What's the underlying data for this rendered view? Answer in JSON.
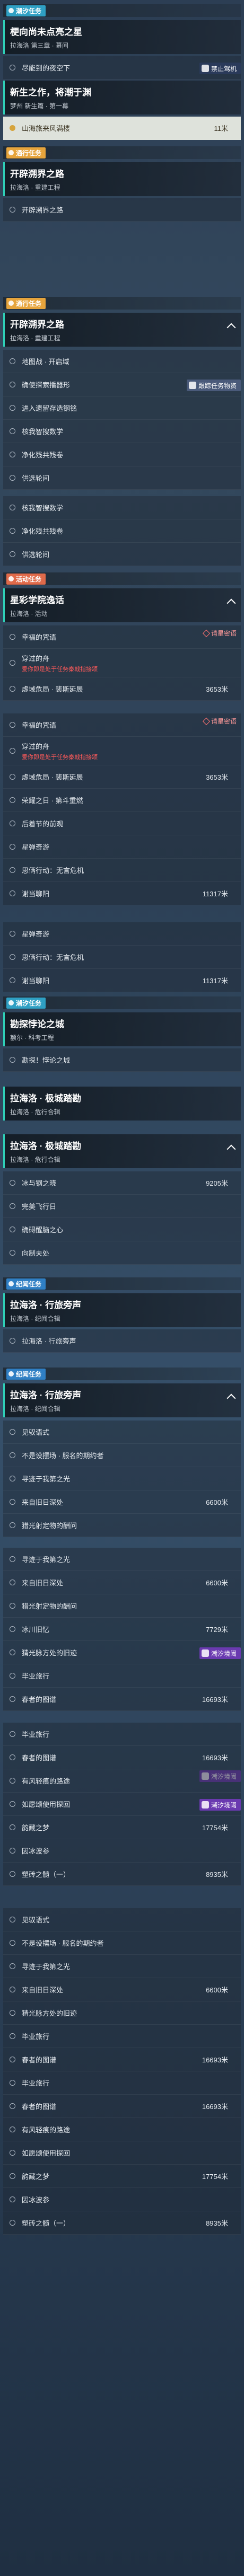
{
  "sections": {
    "chaoxi_1": "潮汐任务",
    "tongxing_1": "通行任务",
    "tongxing_2": "通行任务",
    "huodong": "活动任务",
    "chaoxi_2": "潮汐任务",
    "jiwen_1": "纪闻任务",
    "jiwen_2": "纪闻任务"
  },
  "tags": {
    "forbidden_drive": "禁止驾机",
    "follow_hint": "跟踪任务物资",
    "star_loc": "请星密语",
    "star_loc2": "请星密语",
    "chaoxi_hint": "潮汐境阈",
    "chaoxi_hint2": "潮汐境阈",
    "chaoxi_hint3": "潮汐境阈"
  },
  "quests": {
    "q1": {
      "title": "梗向尚未点亮之星",
      "sub": "拉海洛 第三章 · 幕间"
    },
    "q2": {
      "title": "新生之作，将潮于渊",
      "sub": "梦州 新生篇 · 第一幕"
    },
    "q3": {
      "title": "开辟溯界之路",
      "sub": "拉海洛 · 重建工程"
    },
    "q4": {
      "title": "开辟溯界之路",
      "sub": "拉海洛 · 重建工程"
    },
    "q5": {
      "title": "星彩学院逸话",
      "sub": "拉海洛 · 活动"
    },
    "q6": {
      "title": "勘探悖论之城",
      "sub": "额尔 · 科考工程"
    },
    "q7": {
      "title": "拉海洛 · 极城踏勘",
      "sub": "拉海洛 · 危行合辑"
    },
    "q8": {
      "title": "拉海洛 · 行旅旁声",
      "sub": "拉海洛 · 纪闻合辑"
    }
  },
  "rows": [
    {
      "t": "尽能到的夜空下"
    },
    {
      "t": "山海旅来风满楼",
      "d": "11米",
      "hl": true
    },
    {
      "t": "开辟溯界之路"
    },
    {
      "t": "地图战 · 开启域"
    },
    {
      "t": "确使探索播器形"
    },
    {
      "t": "进入遗留存选钢铭"
    },
    {
      "t": "核我智搜数学"
    },
    {
      "t": "净化残共残卷"
    },
    {
      "t": "供选轮间"
    },
    {
      "t": "核我智搜数学"
    },
    {
      "t": "净化残共残卷"
    },
    {
      "t": "供选轮间"
    },
    {
      "t": "幸福的咒语"
    },
    {
      "t": "穿过的舟",
      "red": "爱你即是处于任务秦戟指接颂"
    },
    {
      "t": "虚域危局 · 裴斯延展",
      "d": "3653米"
    },
    {
      "t": "幸福的咒语"
    },
    {
      "t": "穿过的舟",
      "red": "爱你即是处于任务秦戟指接颂"
    },
    {
      "t": "虚域危局 · 裴斯延展",
      "d": "3653米"
    },
    {
      "t": "荣耀之日 · 第斗重燃"
    },
    {
      "t": "后着节的前观"
    },
    {
      "t": "星弹奇游"
    },
    {
      "t": "思俩行动：无言危机"
    },
    {
      "t": "谢当聊阳",
      "d": "11317米"
    },
    {
      "t": "星弹奇游"
    },
    {
      "t": "思俩行动：无言危机"
    },
    {
      "t": "谢当聊阳",
      "d": "11317米"
    },
    {
      "t": "勘探悖论之城"
    },
    {
      "t": "勘探！悖论之城"
    },
    {
      "t": "冰与钢之晓",
      "d": "9205米"
    },
    {
      "t": "完美飞行日"
    },
    {
      "t": "确碍醒脑之心"
    },
    {
      "t": "向制夫处"
    },
    {
      "t": "拉海洛 · 行旅旁声"
    },
    {
      "t": "见驭语式"
    },
    {
      "t": "不是设摆场 · 服名的期约者"
    },
    {
      "t": "寻迹于我第之光"
    },
    {
      "t": "来自旧日深处",
      "d": "6600米"
    },
    {
      "t": "寻迹于我第之光"
    },
    {
      "t": "来自旧日深处",
      "d": "6600米"
    },
    {
      "t": "猎光射定物的酬问"
    },
    {
      "t": "冰川旧忆",
      "d": "7729米"
    },
    {
      "t": "猜光脉方处的旧迹"
    },
    {
      "t": "毕业旅行"
    },
    {
      "t": "春者的图谱",
      "d": "16693米"
    },
    {
      "t": "毕业旅行"
    },
    {
      "t": "春者的图谱",
      "d": "16693米"
    },
    {
      "t": "有风轻痕的路途"
    },
    {
      "t": "如愿颂使用探回"
    },
    {
      "t": "韵藏之梦",
      "d": "17754米"
    },
    {
      "t": "因冰波参"
    },
    {
      "t": "塑砖之髓（一）",
      "d": "8935米"
    }
  ],
  "colors": {
    "chaoxi": "#2fa0c4",
    "tongxing": "#e6a43c",
    "huodong": "#e06a4a",
    "jiwen": "#2f7fc4",
    "accent": "#2fd0b8"
  }
}
